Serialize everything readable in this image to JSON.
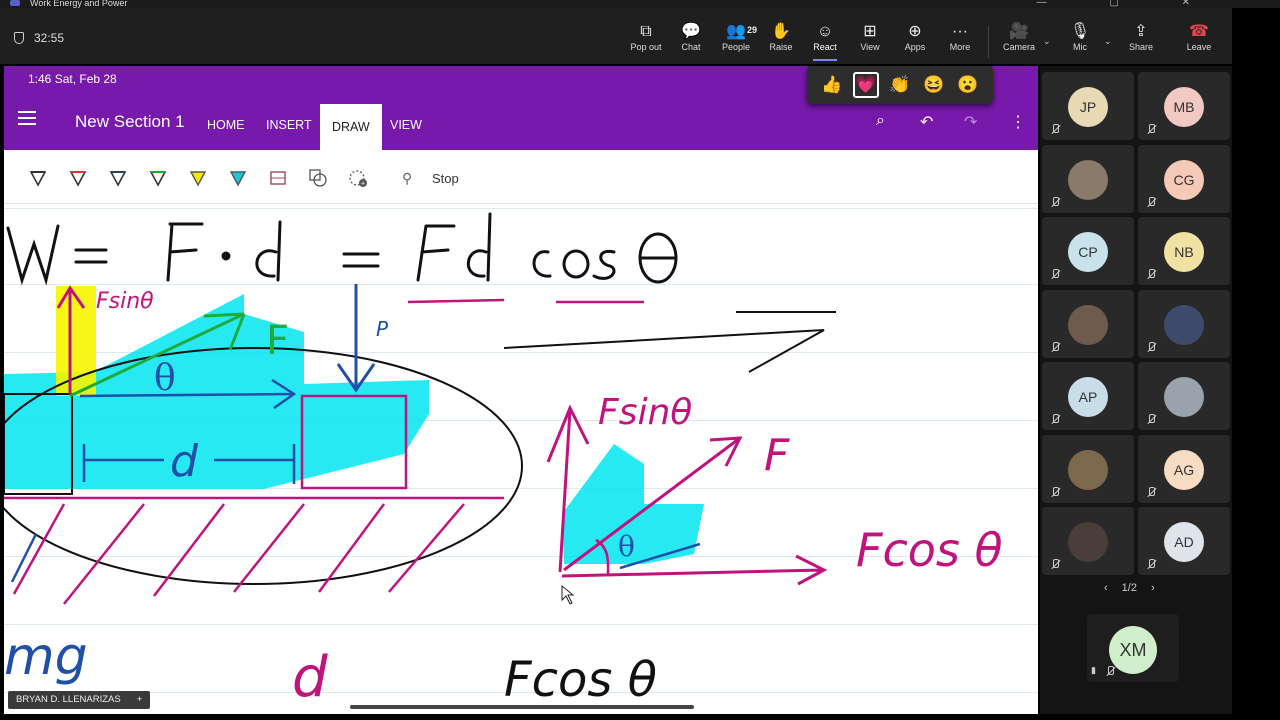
{
  "window": {
    "title": "Work Energy and Power"
  },
  "meeting": {
    "timer": "32:55"
  },
  "toolbar": {
    "buttons": [
      {
        "label": "Pop out",
        "icon": "pop-out-icon"
      },
      {
        "label": "Chat",
        "icon": "chat-icon"
      },
      {
        "label": "People",
        "icon": "people-icon",
        "count": "29"
      },
      {
        "label": "Raise",
        "icon": "raise-hand-icon"
      },
      {
        "label": "React",
        "icon": "react-icon"
      },
      {
        "label": "View",
        "icon": "view-icon"
      },
      {
        "label": "Apps",
        "icon": "apps-icon"
      },
      {
        "label": "More",
        "icon": "more-icon"
      },
      {
        "label": "Camera",
        "icon": "camera-off-icon"
      },
      {
        "label": "Mic",
        "icon": "mic-off-icon"
      },
      {
        "label": "Share",
        "icon": "share-icon"
      },
      {
        "label": "Leave",
        "icon": "leave-icon"
      }
    ]
  },
  "reactions": [
    "👍",
    "💗",
    "👏",
    "😆",
    "😮"
  ],
  "shared_screen": {
    "status_bar": "1:46  Sat, Feb 28",
    "section_title": "New Section 1",
    "tabs": [
      "HOME",
      "INSERT",
      "DRAW",
      "VIEW"
    ],
    "active_tab": "DRAW",
    "stop_label": "Stop",
    "handwriting": {
      "equation": "W = F·d = Fd cos θ",
      "left_labels": [
        "Fsinθ",
        "F",
        "θ",
        "d",
        "P",
        "mg"
      ],
      "right_labels": [
        "Fsinθ",
        "F",
        "θ",
        "Fcos θ"
      ],
      "bottom_labels": [
        "d",
        "Fcos θ"
      ]
    },
    "colors": {
      "onenote_purple": "#7719aa",
      "ink_black": "#111111",
      "ink_blue": "#1f4fa8",
      "ink_magenta": "#c0147c",
      "highlight_cyan": "#00e5f0",
      "highlight_yellow": "#f7f400",
      "ink_green": "#1eaa3c"
    }
  },
  "presenter": {
    "name": "BRYAN D. LLENARIZAS",
    "add": "+"
  },
  "participants": [
    {
      "initials": "JP",
      "color": "#e8d9b5"
    },
    {
      "initials": "MB",
      "color": "#f2c8c2"
    },
    {
      "initials": "",
      "color": "#8a7a6a",
      "photo": true
    },
    {
      "initials": "CG",
      "color": "#f4c9b8"
    },
    {
      "initials": "CP",
      "color": "#c7e2ea"
    },
    {
      "initials": "NB",
      "color": "#f1e1a3"
    },
    {
      "initials": "",
      "color": "#6e5b4e",
      "photo": true
    },
    {
      "initials": "",
      "color": "#3e4a6b",
      "photo": true
    },
    {
      "initials": "AP",
      "color": "#c9dde9"
    },
    {
      "initials": "",
      "color": "#9aa3ad",
      "photo": true
    },
    {
      "initials": "",
      "color": "#7d6a4c",
      "photo": true
    },
    {
      "initials": "AG",
      "color": "#f6dcc2"
    },
    {
      "initials": "",
      "color": "#4a3d3a",
      "photo": true
    },
    {
      "initials": "AD",
      "color": "#dfe4ea"
    }
  ],
  "pager": {
    "label": "1/2",
    "prev": "‹",
    "next": "›"
  },
  "self_tile": {
    "initials": "XM",
    "color": "#cfeec9"
  }
}
